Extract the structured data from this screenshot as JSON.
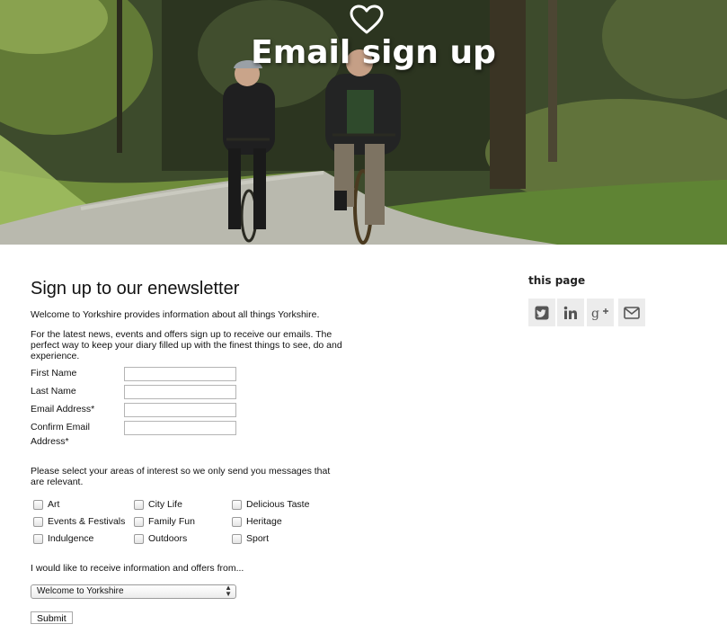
{
  "hero": {
    "title": "Email sign up",
    "icon": "heart-outline-icon"
  },
  "form": {
    "heading": "Sign up to our enewsletter",
    "intro": "Welcome to Yorkshire provides information about all things Yorkshire.",
    "intro2": "For the latest news, events and offers sign up to receive our emails. The perfect way to keep your diary filled up with the finest things to see, do and experience.",
    "fields": [
      {
        "label": "First Name",
        "value": ""
      },
      {
        "label": "Last Name",
        "value": ""
      },
      {
        "label": "Email Address*",
        "value": ""
      },
      {
        "label": "Confirm Email Address*",
        "value": ""
      }
    ],
    "interests_text": "Please select your areas of interest so we only send you messages that are relevant.",
    "interests": [
      "Art",
      "City Life",
      "Delicious Taste",
      "Events & Festivals",
      "Family Fun",
      "Heritage",
      "Indulgence",
      "Outdoors",
      "Sport"
    ],
    "offers_text": "I would like to receive information and offers from...",
    "offers_selected": "Welcome to Yorkshire",
    "submit_label": "Submit"
  },
  "share": {
    "title": "this page",
    "buttons": [
      "twitter-icon",
      "linkedin-icon",
      "google-plus-icon",
      "email-icon"
    ],
    "button_bg": "#ececec",
    "icon_color": "#555555"
  }
}
